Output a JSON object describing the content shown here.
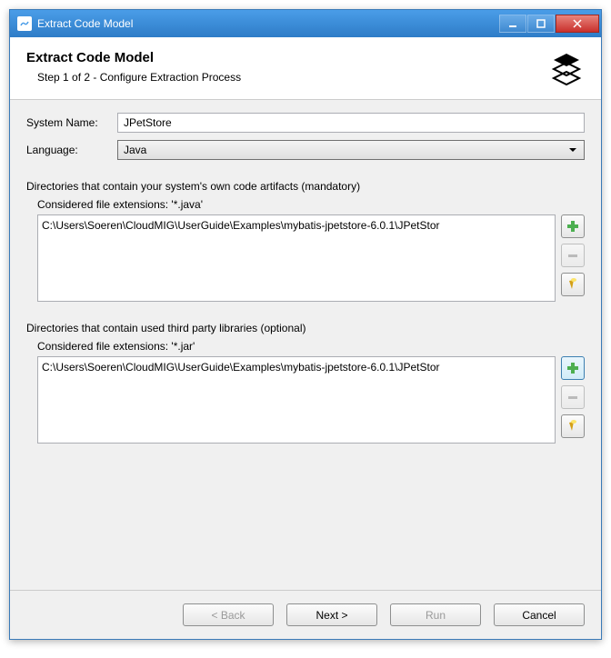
{
  "window": {
    "title": "Extract Code Model"
  },
  "header": {
    "title": "Extract Code Model",
    "subtitle": "Step 1 of 2 - Configure Extraction Process"
  },
  "form": {
    "system_name_label": "System Name:",
    "system_name_value": "JPetStore",
    "language_label": "Language:",
    "language_value": "Java"
  },
  "own_code": {
    "description": "Directories that contain your system's own code artifacts (mandatory)",
    "ext_label": "Considered file extensions:  '*.java'",
    "items": [
      "C:\\Users\\Soeren\\CloudMIG\\UserGuide\\Examples\\mybatis-jpetstore-6.0.1\\JPetStor"
    ]
  },
  "third_party": {
    "description": "Directories that contain used third party libraries (optional)",
    "ext_label": "Considered file extensions:  '*.jar'",
    "items": [
      "C:\\Users\\Soeren\\CloudMIG\\UserGuide\\Examples\\mybatis-jpetstore-6.0.1\\JPetStor"
    ]
  },
  "footer": {
    "back": "< Back",
    "next": "Next >",
    "run": "Run",
    "cancel": "Cancel"
  }
}
